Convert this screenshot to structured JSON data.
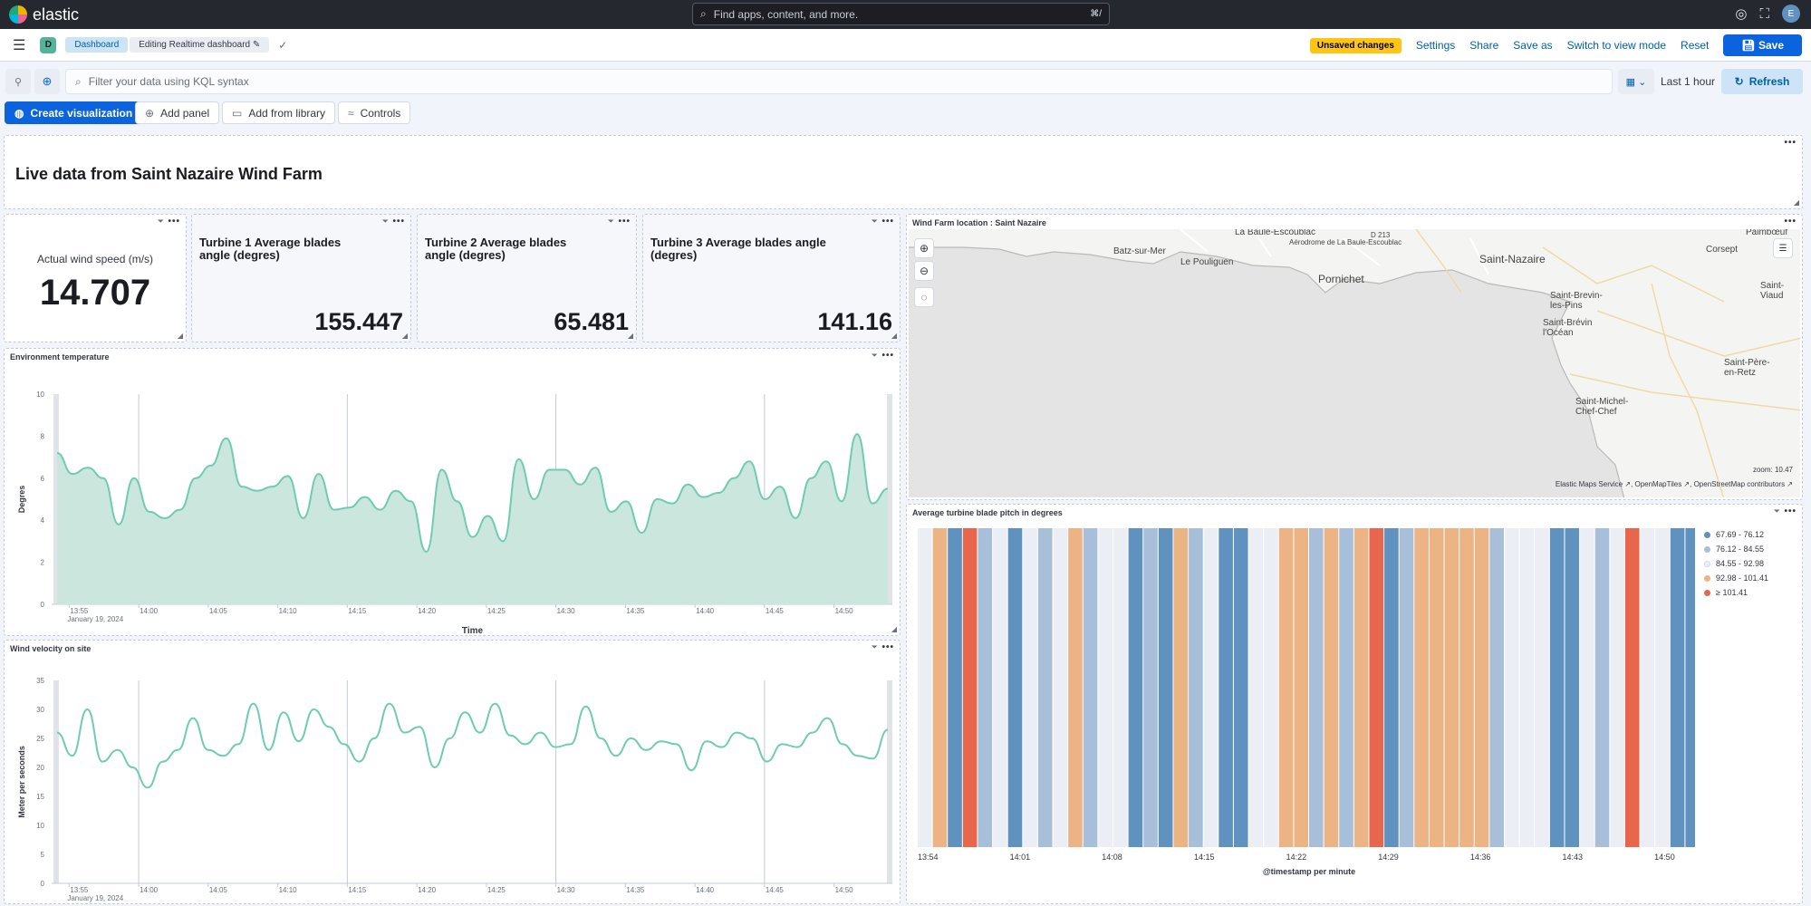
{
  "brand": {
    "logo_text": "elastic"
  },
  "search": {
    "placeholder": "Find apps, content, and more.",
    "shortcut": "⌘/"
  },
  "user": {
    "avatar_initial": "E"
  },
  "header": {
    "space_initial": "D",
    "breadcrumb_dashboard": "Dashboard",
    "breadcrumb_current": "Editing Realtime dashboard",
    "unsaved_badge": "Unsaved changes",
    "settings": "Settings",
    "share": "Share",
    "save_as": "Save as",
    "switch_view": "Switch to view mode",
    "reset": "Reset",
    "save": "Save"
  },
  "query": {
    "placeholder": "Filter your data using KQL syntax",
    "time_range": "Last 1 hour",
    "refresh": "Refresh"
  },
  "actions": {
    "create_viz": "Create visualization",
    "add_panel": "Add panel",
    "add_library": "Add from library",
    "controls": "Controls"
  },
  "panels": {
    "header_markdown": "Live data from Saint Nazaire Wind Farm",
    "wind_speed": {
      "label": "Actual wind speed (m/s)",
      "value": "14.707"
    },
    "turbine1": {
      "title_line1": "Turbine 1 Average blades",
      "title_line2": "angle (degres)",
      "value": "155.447"
    },
    "turbine2": {
      "title_line1": "Turbine 2 Average blades",
      "title_line2": "angle (degres)",
      "value": "65.481"
    },
    "turbine3": {
      "title_line1": "Turbine 3 Average blades angle",
      "title_line2": "(degres)",
      "value": "141.16"
    },
    "map": {
      "title": "Wind Farm location : Saint Nazaire",
      "zoom_label": "zoom: 10.47",
      "attribution": "Elastic Maps Service ↗, OpenMapTiles ↗, OpenStreetMap contributors ↗",
      "places": {
        "la_baule": "La Baule-Escoublac",
        "aerodrome": "Aérodrome de La Baule-Escoublac",
        "d213": "D 213",
        "batz": "Batz-sur-Mer",
        "pouliguen": "Le Pouliguen",
        "pornichet": "Pornichet",
        "saint_nazaire": "Saint-Nazaire",
        "paimboeuf": "Paimbœuf",
        "corsept": "Corsept",
        "saint_viaud": "Saint-Viaud",
        "saint_brevin_pins": "Saint-Brevin-les-Pins",
        "saint_brevin_ocean": "Saint-Brévin l'Océan",
        "saint_pere": "Saint-Père-en-Retz",
        "saint_michel": "Saint-Michel-Chef-Chef"
      }
    },
    "env_temp_title": "Environment temperature",
    "wind_velocity_title": "Wind velocity on site",
    "blade_pitch_title": "Average turbine blade pitch in degrees"
  },
  "colors": {
    "accent": "#0b64dd",
    "area_fill": "#cbe6dd",
    "area_line": "#6dccb1",
    "bin1": "#6092c0",
    "bin2": "#a8bfda",
    "bin3": "#ebeff5",
    "bin4": "#ecb385",
    "bin5": "#e7664c"
  },
  "chart_data": [
    {
      "id": "env_temp",
      "type": "area",
      "xlabel": "Time",
      "ylabel": "Degres",
      "ylim": [
        0,
        10
      ],
      "yticks": [
        0,
        2,
        4,
        6,
        8,
        10
      ],
      "x_start": "13:54",
      "x_end": "14:54",
      "xtick_labels": [
        "13:55",
        "14:00",
        "14:05",
        "14:10",
        "14:15",
        "14:20",
        "14:25",
        "14:30",
        "14:35",
        "14:40",
        "14:45",
        "14:50"
      ],
      "date_label": "January 19, 2024",
      "grid": false,
      "values": [
        7.2,
        6.2,
        6.5,
        6.0,
        3.8,
        6.0,
        4.4,
        4.1,
        4.5,
        6.0,
        6.6,
        7.9,
        5.6,
        5.4,
        5.6,
        6.1,
        4.1,
        6.2,
        4.5,
        4.6,
        5.1,
        4.5,
        5.4,
        4.9,
        2.5,
        6.4,
        4.9,
        3.2,
        4.2,
        3.0,
        6.9,
        5.0,
        6.4,
        6.4,
        5.7,
        6.5,
        4.4,
        4.9,
        3.4,
        5.0,
        4.8,
        5.7,
        5.1,
        5.3,
        6.0,
        6.8,
        5.0,
        5.6,
        4.1,
        6.0,
        6.8,
        4.9,
        8.1,
        4.8,
        5.5
      ]
    },
    {
      "id": "wind_velocity",
      "type": "line",
      "xlabel": "",
      "ylabel": "Meter per seconds",
      "ylim": [
        0,
        35
      ],
      "yticks": [
        0,
        5,
        10,
        15,
        20,
        25,
        30,
        35
      ],
      "x_start": "13:54",
      "x_end": "14:54",
      "xtick_labels": [
        "13:55",
        "14:00",
        "14:05",
        "14:10",
        "14:15",
        "14:20",
        "14:25",
        "14:30",
        "14:35",
        "14:40",
        "14:45",
        "14:50"
      ],
      "date_label": "January 19, 2024",
      "grid": false,
      "values": [
        26,
        22,
        30,
        21,
        23,
        20,
        16.5,
        21,
        23,
        28.5,
        23,
        22,
        24,
        31,
        23,
        29.5,
        24.5,
        30,
        27,
        24,
        21,
        25,
        31,
        26,
        27,
        20,
        25,
        29.5,
        26,
        31,
        25.5,
        24,
        26,
        23.5,
        24,
        30.5,
        25,
        22,
        25,
        23,
        24.5,
        24,
        19.5,
        24.5,
        23.5,
        26,
        25,
        21,
        24,
        23.5,
        26,
        28.5,
        24,
        22,
        21.5,
        26.5
      ]
    },
    {
      "id": "blade_pitch",
      "type": "heatmap",
      "xlabel": "@timestamp per minute",
      "ylabel": "",
      "xtick_labels": [
        "13:54",
        "14:01",
        "14:08",
        "14:15",
        "14:22",
        "14:29",
        "14:36",
        "14:43",
        "14:50"
      ],
      "legend": [
        "67.69 - 76.12",
        "76.12 - 84.55",
        "84.55 - 92.98",
        "92.98 - 101.41",
        "≥ 101.41"
      ],
      "legend_position": "right",
      "bins": [
        3,
        4,
        1,
        5,
        2,
        3,
        1,
        3,
        2,
        3,
        4,
        2,
        3,
        3,
        1,
        2,
        1,
        4,
        2,
        3,
        1,
        1,
        3,
        3,
        4,
        4,
        2,
        4,
        2,
        4,
        5,
        1,
        2,
        4,
        4,
        4,
        4,
        4,
        2,
        3,
        3,
        3,
        1,
        1,
        3,
        2,
        3,
        5,
        3,
        3,
        1,
        1
      ]
    }
  ]
}
